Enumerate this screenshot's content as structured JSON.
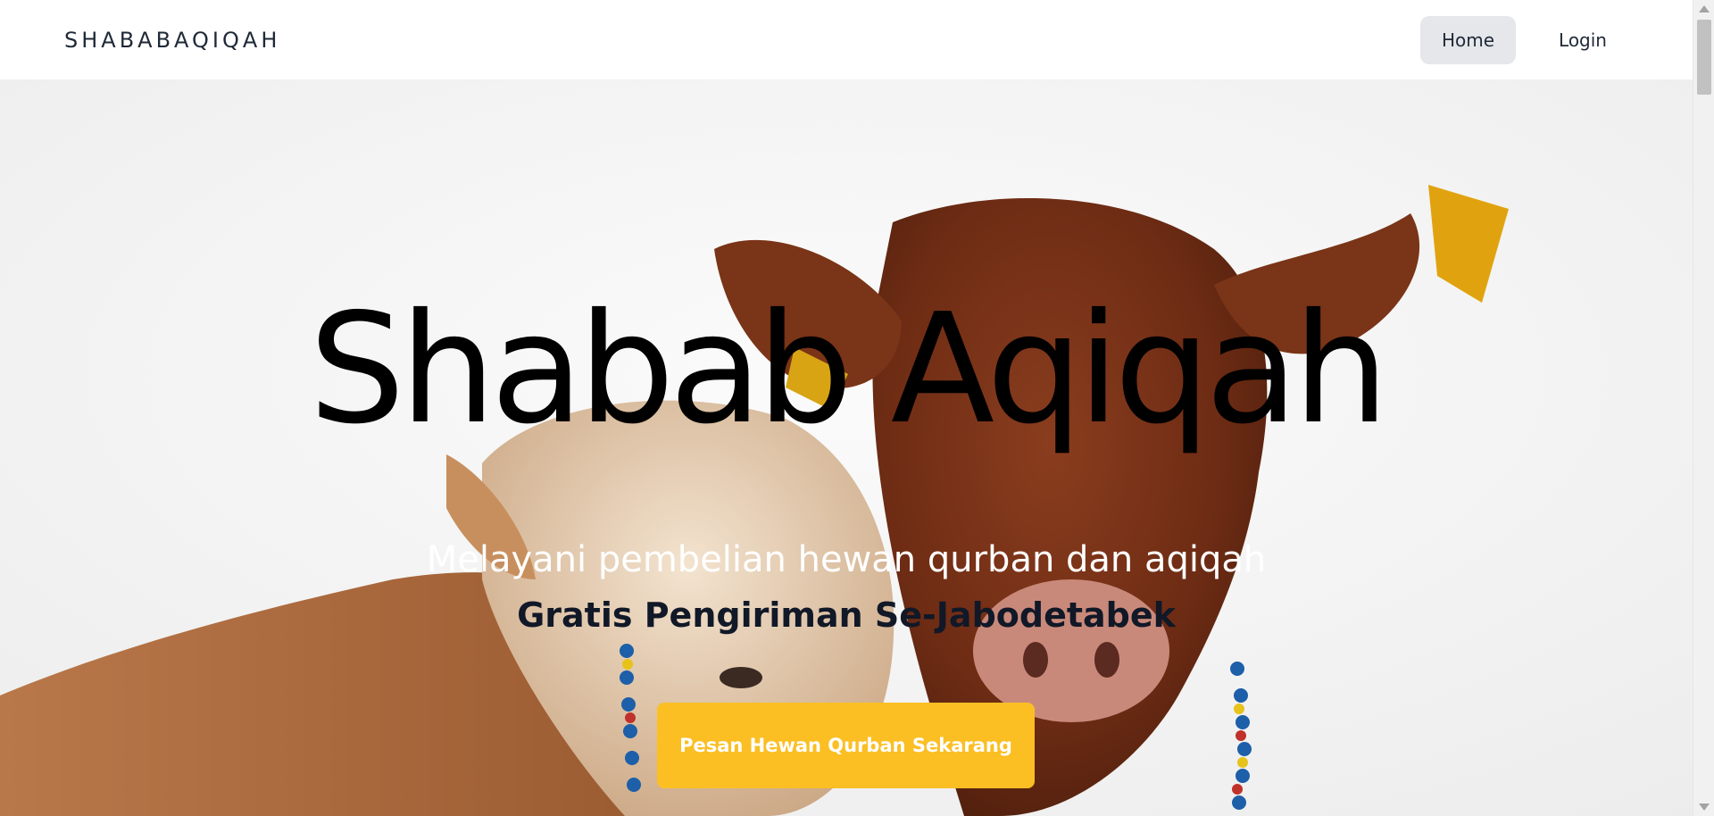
{
  "navbar": {
    "brand": "SHABABAQIQAH",
    "links": [
      {
        "label": "Home",
        "active": true
      },
      {
        "label": "Login",
        "active": false
      }
    ]
  },
  "hero": {
    "title": "Shabab  Aqiqah",
    "subtitle": "Melayani pembelian hewan qurban dan aqiqah",
    "tagline": "Gratis Pengiriman Se-Jabodetabek",
    "cta_label": "Pesan Hewan Qurban Sekarang",
    "image": "two-cows-photo"
  },
  "colors": {
    "accent": "#fbbf24",
    "active_nav_bg": "#e5e7eb",
    "text_dark": "#111827"
  }
}
